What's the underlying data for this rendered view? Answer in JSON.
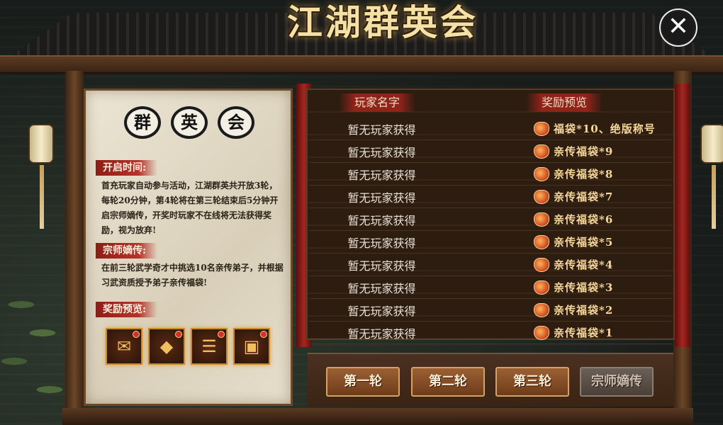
{
  "title": "江湖群英会",
  "close_icon_glyph": "✕",
  "emblems": [
    "群",
    "英",
    "会"
  ],
  "open_time": {
    "label": "开启时间:",
    "text": "首充玩家自动参与活动，江湖群英共开放3轮，每轮20分钟，第4轮将在第三轮结束后5分钟开启宗师嫡传，开奖时玩家不在线将无法获得奖励，视为放弃!"
  },
  "master": {
    "label": "宗师嫡传:",
    "text": "在前三轮武学奇才中挑选10名亲传弟子，并根据习武资质授予弟子亲传福袋!"
  },
  "reward_preview": {
    "label": "奖励预览:",
    "items": [
      {
        "icon": "red-envelope-icon",
        "glyph": "✉"
      },
      {
        "icon": "blue-pouch-icon",
        "glyph": "◆"
      },
      {
        "icon": "scroll-icon",
        "glyph": "☰"
      },
      {
        "icon": "treasure-chest-icon",
        "glyph": "▣"
      }
    ]
  },
  "table": {
    "col_player": "玩家名字",
    "col_reward": "奖励预览",
    "rows": [
      {
        "player": "暂无玩家获得",
        "reward": "福袋*10、绝版称号"
      },
      {
        "player": "暂无玩家获得",
        "reward": "亲传福袋*9"
      },
      {
        "player": "暂无玩家获得",
        "reward": "亲传福袋*8"
      },
      {
        "player": "暂无玩家获得",
        "reward": "亲传福袋*7"
      },
      {
        "player": "暂无玩家获得",
        "reward": "亲传福袋*6"
      },
      {
        "player": "暂无玩家获得",
        "reward": "亲传福袋*5"
      },
      {
        "player": "暂无玩家获得",
        "reward": "亲传福袋*4"
      },
      {
        "player": "暂无玩家获得",
        "reward": "亲传福袋*3"
      },
      {
        "player": "暂无玩家获得",
        "reward": "亲传福袋*2"
      },
      {
        "player": "暂无玩家获得",
        "reward": "亲传福袋*1"
      }
    ]
  },
  "rounds": [
    {
      "label": "第一轮",
      "enabled": true
    },
    {
      "label": "第二轮",
      "enabled": true
    },
    {
      "label": "第三轮",
      "enabled": true
    },
    {
      "label": "宗师嫡传",
      "enabled": false
    }
  ],
  "colors": {
    "accent_red": "#8e1d16",
    "gold_text": "#f6d89a",
    "button_brown": "#9c6034"
  }
}
